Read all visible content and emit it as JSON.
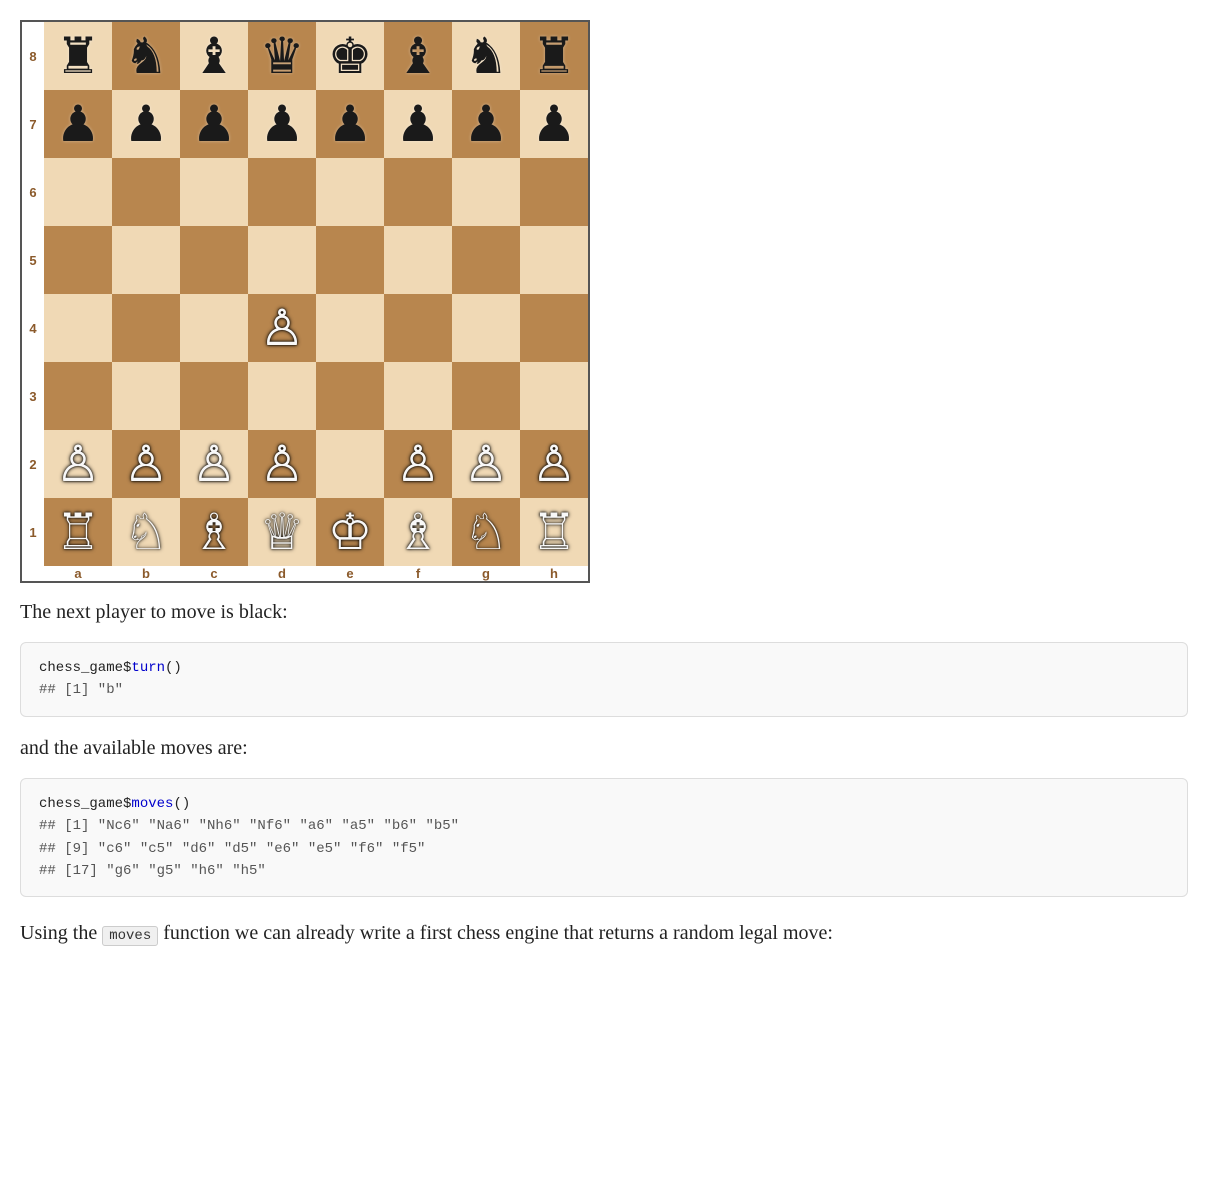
{
  "board": {
    "ranks": [
      "8",
      "7",
      "6",
      "5",
      "4",
      "3",
      "2",
      "1"
    ],
    "files": [
      "a",
      "b",
      "c",
      "d",
      "e",
      "f",
      "g",
      "h"
    ],
    "pieces": {
      "a8": {
        "type": "rook",
        "color": "black",
        "symbol": "♜"
      },
      "b8": {
        "type": "knight",
        "color": "black",
        "symbol": "♞"
      },
      "c8": {
        "type": "bishop",
        "color": "black",
        "symbol": "♝"
      },
      "d8": {
        "type": "queen",
        "color": "black",
        "symbol": "♛"
      },
      "e8": {
        "type": "king",
        "color": "black",
        "symbol": "♚"
      },
      "f8": {
        "type": "bishop",
        "color": "black",
        "symbol": "♝"
      },
      "g8": {
        "type": "knight",
        "color": "black",
        "symbol": "♞"
      },
      "h8": {
        "type": "rook",
        "color": "black",
        "symbol": "♜"
      },
      "a7": {
        "type": "pawn",
        "color": "black",
        "symbol": "♟"
      },
      "b7": {
        "type": "pawn",
        "color": "black",
        "symbol": "♟"
      },
      "c7": {
        "type": "pawn",
        "color": "black",
        "symbol": "♟"
      },
      "d7": {
        "type": "pawn",
        "color": "black",
        "symbol": "♟"
      },
      "e7": {
        "type": "pawn",
        "color": "black",
        "symbol": "♟"
      },
      "f7": {
        "type": "pawn",
        "color": "black",
        "symbol": "♟"
      },
      "g7": {
        "type": "pawn",
        "color": "black",
        "symbol": "♟"
      },
      "h7": {
        "type": "pawn",
        "color": "black",
        "symbol": "♟"
      },
      "d4": {
        "type": "pawn",
        "color": "white",
        "symbol": "♙"
      },
      "a2": {
        "type": "pawn",
        "color": "white",
        "symbol": "♙"
      },
      "b2": {
        "type": "pawn",
        "color": "white",
        "symbol": "♙"
      },
      "c2": {
        "type": "pawn",
        "color": "white",
        "symbol": "♙"
      },
      "d2": {
        "type": "pawn",
        "color": "white",
        "symbol": "♙"
      },
      "f2": {
        "type": "pawn",
        "color": "white",
        "symbol": "♙"
      },
      "g2": {
        "type": "pawn",
        "color": "white",
        "symbol": "♙"
      },
      "h2": {
        "type": "pawn",
        "color": "white",
        "symbol": "♙"
      },
      "a1": {
        "type": "rook",
        "color": "white",
        "symbol": "♖"
      },
      "b1": {
        "type": "knight",
        "color": "white",
        "symbol": "♘"
      },
      "c1": {
        "type": "bishop",
        "color": "white",
        "symbol": "♗"
      },
      "d1": {
        "type": "queen",
        "color": "white",
        "symbol": "♕"
      },
      "e1": {
        "type": "king",
        "color": "white",
        "symbol": "♔"
      },
      "f1": {
        "type": "bishop",
        "color": "white",
        "symbol": "♗"
      },
      "g1": {
        "type": "knight",
        "color": "white",
        "symbol": "♘"
      },
      "h1": {
        "type": "rook",
        "color": "white",
        "symbol": "♖"
      }
    }
  },
  "text": {
    "next_player": "The next player to move is black:",
    "and_available": "and the available moves are:",
    "using_the": "Using the",
    "using_rest": "function we can already write a first chess engine that returns a random legal move:",
    "inline_code": "moves"
  },
  "code_block_turn": {
    "line1": "chess_game$turn()",
    "line2": "## [1] \"b\""
  },
  "code_block_moves": {
    "line1": "chess_game$moves()",
    "line2": "##   [1] \"Nc6\" \"Na6\" \"Nh6\" \"Nf6\" \"a6\"  \"a5\"  \"b6\"  \"b5\"",
    "line3": "##   [9] \"c6\"  \"c5\"  \"d6\"  \"d5\"  \"e6\"  \"e5\"  \"f6\"  \"f5\"",
    "line4": "## [17] \"g6\"  \"g5\"  \"h6\"  \"h5\""
  }
}
